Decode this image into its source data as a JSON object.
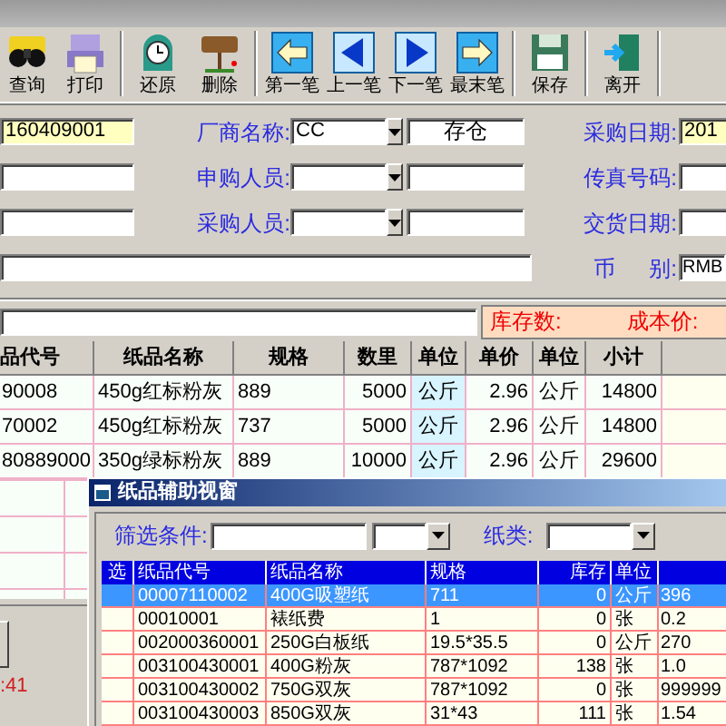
{
  "toolbar": [
    {
      "label": "查询"
    },
    {
      "label": "打印"
    },
    {
      "label": "还原"
    },
    {
      "label": "删除"
    },
    {
      "label": "第一笔"
    },
    {
      "label": "上一笔"
    },
    {
      "label": "下一笔"
    },
    {
      "label": "最末笔"
    },
    {
      "label": "保存"
    },
    {
      "label": "离开"
    }
  ],
  "order_no": "160409001",
  "vendor": {
    "label": "厂商名称:",
    "value": "CC",
    "note": "存仓"
  },
  "requester": {
    "label": "申购人员:"
  },
  "buyer": {
    "label": "采购人员:"
  },
  "purchase_date": {
    "label": "采购日期:",
    "value": "201"
  },
  "fax": {
    "label": "传真号码:"
  },
  "delivery_date": {
    "label": "交货日期:"
  },
  "currency": {
    "label_parts": [
      "币",
      "别:"
    ],
    "value": "RMB"
  },
  "stock_panel": {
    "stock_label": "库存数:",
    "cost_label": "成本价:"
  },
  "items_table": {
    "columns": [
      {
        "title": "品代号",
        "selected": false
      },
      {
        "title": "纸品名称",
        "selected": false
      },
      {
        "title": "规格",
        "selected": false
      },
      {
        "title": "数里",
        "selected": false
      },
      {
        "title": "单位",
        "selected": true
      },
      {
        "title": "单价",
        "selected": false
      },
      {
        "title": "单位",
        "selected": false
      },
      {
        "title": "小计",
        "selected": false
      }
    ],
    "rows": [
      [
        "90008",
        "450g红标粉灰",
        "889",
        "5000",
        "公斤",
        "2.96",
        "公斤",
        "14800"
      ],
      [
        "70002",
        "450g红标粉灰",
        "737",
        "5000",
        "公斤",
        "2.96",
        "公斤",
        "14800"
      ],
      [
        "80889000",
        "350g绿标粉灰",
        "889",
        "10000",
        "公斤",
        "2.96",
        "公斤",
        "29600"
      ]
    ]
  },
  "clock_text": ":41",
  "popup": {
    "title": "纸品辅助视窗",
    "filter_label": "筛选条件:",
    "type_label": "纸类:",
    "columns": [
      "选",
      "纸品代号",
      "纸品名称",
      "规格",
      "库存",
      "单位"
    ],
    "rows": [
      {
        "selected": true,
        "cells": [
          "",
          "00007110002",
          "400G吸塑纸",
          "711",
          "0",
          "公斤",
          "396"
        ]
      },
      {
        "selected": false,
        "cells": [
          "",
          "00010001",
          "裱纸费",
          "1",
          "0",
          "张",
          "0.2"
        ]
      },
      {
        "selected": false,
        "cells": [
          "",
          "002000360001",
          "250G白板纸",
          "19.5*35.5",
          "0",
          "公斤",
          "270"
        ]
      },
      {
        "selected": false,
        "cells": [
          "",
          "003100430001",
          "400G粉灰",
          "787*1092",
          "138",
          "张",
          "1.0"
        ]
      },
      {
        "selected": false,
        "cells": [
          "",
          "003100430002",
          "750G双灰",
          "787*1092",
          "0",
          "张",
          "999999"
        ]
      },
      {
        "selected": false,
        "cells": [
          "",
          "003100430003",
          "850G双灰",
          "31*43",
          "111",
          "张",
          "1.54"
        ]
      }
    ]
  }
}
